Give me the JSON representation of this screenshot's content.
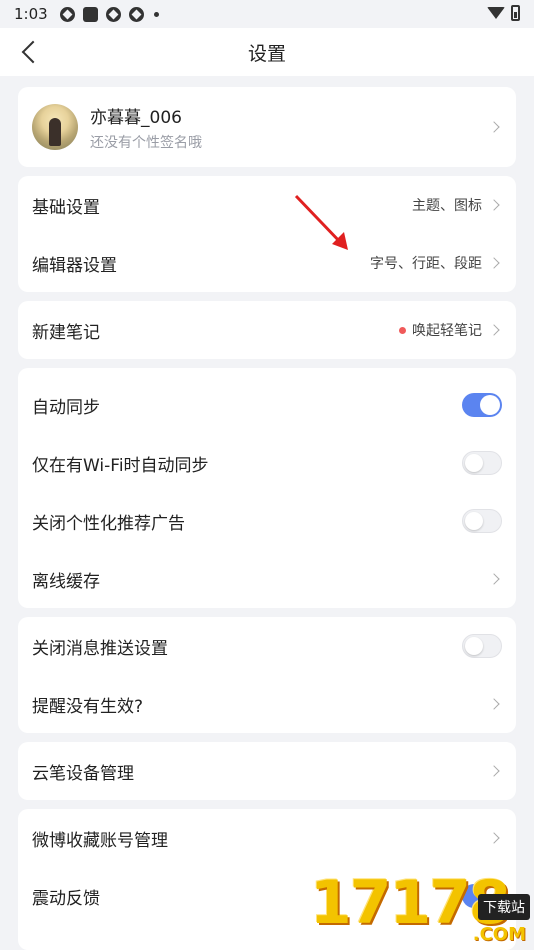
{
  "status_bar": {
    "time": "1:03"
  },
  "nav": {
    "title": "设置"
  },
  "profile": {
    "name": "亦暮暮_006",
    "signature": "还没有个性签名哦"
  },
  "basic_group": {
    "basic_label": "基础设置",
    "basic_value": "主题、图标",
    "editor_label": "编辑器设置",
    "editor_value": "字号、行距、段距"
  },
  "new_note": {
    "label": "新建笔记",
    "value": "唤起轻笔记",
    "dot_color": "#f05a5a"
  },
  "sync_group": {
    "auto_sync_label": "自动同步",
    "auto_sync_on": true,
    "wifi_sync_label": "仅在有Wi-Fi时自动同步",
    "wifi_sync_on": false,
    "ads_label": "关闭个性化推荐广告",
    "ads_on": false,
    "offline_label": "离线缓存"
  },
  "push_group": {
    "push_label": "关闭消息推送设置",
    "push_on": false,
    "reminder_label": "提醒没有生效?"
  },
  "pen_group": {
    "pen_label": "云笔设备管理"
  },
  "misc_group": {
    "weibo_label": "微博收藏账号管理",
    "vibrate_label": "震动反馈",
    "vibrate_on": true
  },
  "watermark": {
    "number": "17178",
    "tag": "下载站",
    "domain": ".COM"
  },
  "colors": {
    "accent": "#5b84f0",
    "background": "#f2f3f6",
    "arrow": "#e02020"
  }
}
